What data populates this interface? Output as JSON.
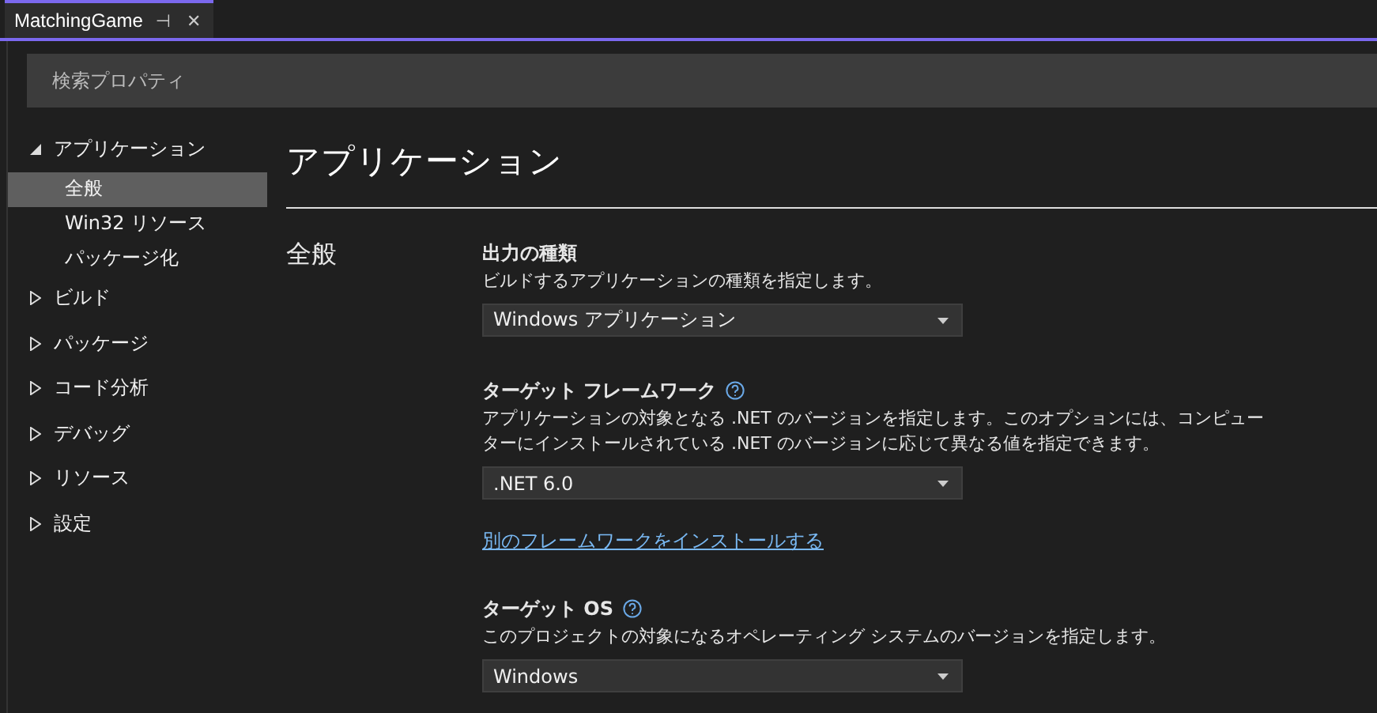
{
  "tab": {
    "title": "MatchingGame",
    "pin": "⊣",
    "close": "✕",
    "selected": true
  },
  "search": {
    "placeholder": "検索プロパティ"
  },
  "sidebar": {
    "items": [
      {
        "label": "アプリケーション",
        "expanded": true,
        "selected": false,
        "children": [
          {
            "label": "全般",
            "selected": true
          },
          {
            "label": "Win32 リソース",
            "selected": false
          },
          {
            "label": "パッケージ化",
            "selected": false
          }
        ]
      },
      {
        "label": "ビルド",
        "expanded": false,
        "selected": false
      },
      {
        "label": "パッケージ",
        "expanded": false,
        "selected": false
      },
      {
        "label": "コード分析",
        "expanded": false,
        "selected": false
      },
      {
        "label": "デバッグ",
        "expanded": false,
        "selected": false
      },
      {
        "label": "リソース",
        "expanded": false,
        "selected": false
      },
      {
        "label": "設定",
        "expanded": false,
        "selected": false
      }
    ]
  },
  "page_title": "アプリケーション",
  "section": {
    "title": "全般",
    "settings": [
      {
        "kind": "dropdown",
        "label": "出力の種類",
        "help": false,
        "description": "ビルドするアプリケーションの種類を指定します。",
        "value": "Windows アプリケーション"
      },
      {
        "kind": "dropdown",
        "label": "ターゲット フレームワーク",
        "help": true,
        "description": "アプリケーションの対象となる .NET のバージョンを指定します。このオプションには、コンピューターにインストールされている .NET のバージョンに応じて異なる値を指定できます。",
        "value": ".NET 6.0",
        "link": "別のフレームワークをインストールする"
      },
      {
        "kind": "dropdown",
        "label": "ターゲット OS",
        "help": true,
        "description": "このプロジェクトの対象になるオペレーティング システムのバージョンを指定します。",
        "value": "Windows"
      }
    ]
  }
}
